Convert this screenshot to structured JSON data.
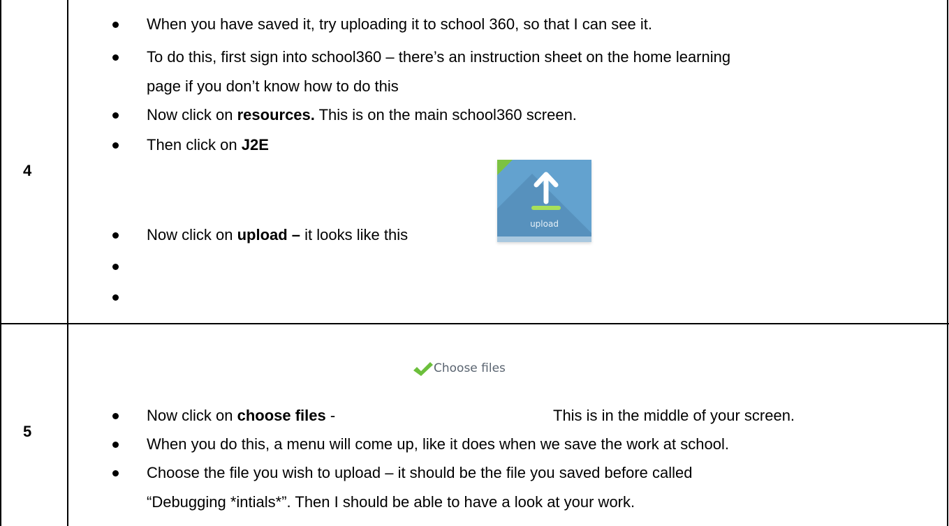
{
  "rows": [
    {
      "number": "4",
      "bullets": [
        {
          "text": "When you have saved it, try uploading it to school 360, so that I can see it."
        },
        {
          "text": "To do this, first sign into school360 – there’s an instruction sheet on the home learning"
        },
        {
          "text": "page if you don’t know how to do this"
        },
        {
          "pre": "Now click on ",
          "bold": "resources.",
          "post": " This is on the main school360 screen."
        },
        {
          "pre": "Then click on ",
          "bold": "J2E",
          "post": ""
        },
        {
          "pre": "Now click on ",
          "bold": "upload –",
          "post": " it looks like this"
        },
        {
          "text": ""
        },
        {
          "text": ""
        }
      ],
      "upload_icon": {
        "icon": "upload-arrow-icon",
        "label": "upload",
        "color_bg": "#63a2cf",
        "color_accent": "#7cc242"
      }
    },
    {
      "number": "5",
      "bullets": [
        {
          "pre": "Now click on ",
          "bold": "choose files",
          "post": " -",
          "after": "This is in the middle of your screen."
        },
        {
          "text": "When you do this, a menu will come up, like it does when we save the work at school."
        },
        {
          "text": "Choose the file you wish to upload – it should be the file you saved before called"
        },
        {
          "text": "“Debugging *intials*”. Then I should be able to have a look at your work."
        }
      ],
      "choose_files": {
        "icon": "checkmark-icon",
        "label": "Choose files",
        "color_check": "#6cbf3c"
      }
    }
  ]
}
